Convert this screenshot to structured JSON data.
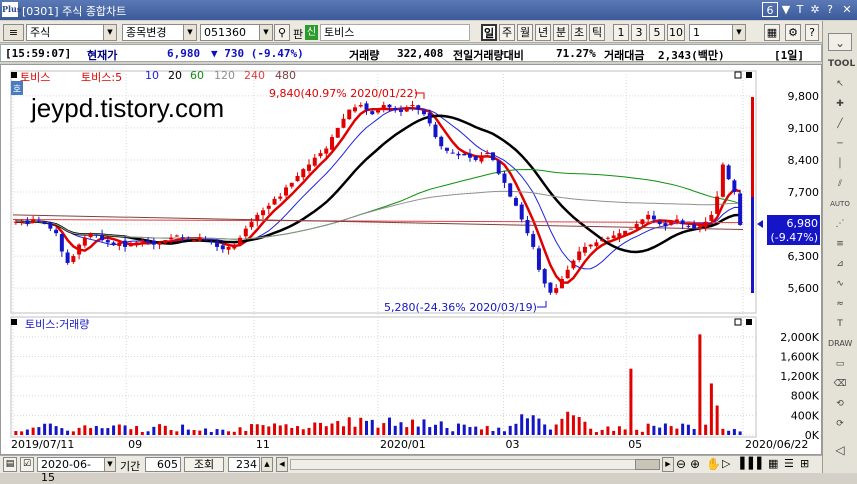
{
  "window": {
    "screen_code": "[0301]",
    "title": "주식 종합차트",
    "logo": "Plus",
    "window_index": "6"
  },
  "toolbar": {
    "market_type": "주식",
    "item_change_label": "종목변경",
    "stock_code": "051360",
    "tray_label": "판",
    "credit_badge": "신",
    "stock_name": "토비스",
    "periods": [
      "일",
      "주",
      "월",
      "년",
      "분",
      "초",
      "틱"
    ],
    "active_period": "일",
    "intervals": [
      "1",
      "3",
      "5",
      "10"
    ],
    "interval_value": "1"
  },
  "info": {
    "time": "[15:59:07]",
    "price_label": "현재가",
    "price": "6,980",
    "change": "▼  730 (-9.47%)",
    "volume_label": "거래량",
    "volume": "322,408",
    "prev_vol_label": "전일거래량대비",
    "prev_vol_ratio": "71.27%",
    "amount_label": "거래대금",
    "amount": "2,343(백만)",
    "period_badge": "[1일]"
  },
  "price_panel": {
    "legend": [
      {
        "text": "토비스",
        "color": "#e00000"
      },
      {
        "text": "토비스:5",
        "color": "#e00000"
      },
      {
        "text": "10",
        "color": "#2020e0"
      },
      {
        "text": "20",
        "color": "#000000"
      },
      {
        "text": "60",
        "color": "#109010"
      },
      {
        "text": "120",
        "color": "#909090"
      },
      {
        "text": "240",
        "color": "#e04040"
      },
      {
        "text": "480",
        "color": "#804040"
      }
    ],
    "side_tag": "호",
    "watermark": "jeypd.tistory.com",
    "high_annotation": "9,840(40.97% 2020/01/22)",
    "low_annotation": "5,280(-24.36% 2020/03/19)",
    "current_price": "6,980",
    "current_change": "(-9.47%)"
  },
  "volume_panel": {
    "legend": "토비스:거래량"
  },
  "x_axis": {
    "start_date": "2019/07/11",
    "end_date": "2020/06/22"
  },
  "bottom": {
    "date": "2020-06-15",
    "period_label": "기간",
    "period_value": "605",
    "query_label": "조회",
    "query_value": "234"
  },
  "chart_data": {
    "type": "candlestick",
    "price_axis": {
      "ticks": [
        "9,800",
        "9,100",
        "8,400",
        "7,700",
        "7,000",
        "6,300",
        "5,600"
      ],
      "ylim": [
        5100,
        10300
      ]
    },
    "volume_axis": {
      "ticks": [
        "2,000K",
        "1,600K",
        "1,200K",
        "800K",
        "400K",
        "0K"
      ],
      "ylim": [
        0,
        2200000
      ]
    },
    "x_ticks": [
      "2019/07/11",
      "09",
      "11",
      "2020/01",
      "03",
      "05",
      "2020/06/22"
    ],
    "close": [
      7050,
      7050,
      7000,
      7100,
      7050,
      7000,
      6900,
      6800,
      6400,
      6150,
      6300,
      6550,
      6700,
      6800,
      6750,
      6650,
      6600,
      6550,
      6600,
      6500,
      6550,
      6600,
      6650,
      6600,
      6550,
      6600,
      6650,
      6700,
      6750,
      6700,
      6650,
      6650,
      6700,
      6650,
      6600,
      6500,
      6450,
      6500,
      6550,
      6700,
      6900,
      7050,
      7200,
      7300,
      7400,
      7550,
      7600,
      7800,
      7900,
      8050,
      8200,
      8300,
      8450,
      8550,
      8650,
      8900,
      9100,
      9300,
      9500,
      9550,
      9600,
      9500,
      9400,
      9500,
      9600,
      9550,
      9500,
      9450,
      9550,
      9600,
      9500,
      9400,
      9200,
      8900,
      8700,
      8600,
      8550,
      8500,
      8500,
      8450,
      8400,
      8500,
      8550,
      8400,
      8100,
      7900,
      7600,
      7400,
      7100,
      6800,
      6500,
      6000,
      5700,
      5500,
      5600,
      5800,
      6000,
      6200,
      6400,
      6500,
      6550,
      6600,
      6650,
      6700,
      6750,
      6800,
      6850,
      6900,
      7000,
      7100,
      7200,
      7100,
      7000,
      6950,
      7050,
      7100,
      7000,
      6950,
      6900,
      6950,
      7050,
      7200,
      7600,
      8300,
      7980,
      7700,
      6980
    ]
  }
}
